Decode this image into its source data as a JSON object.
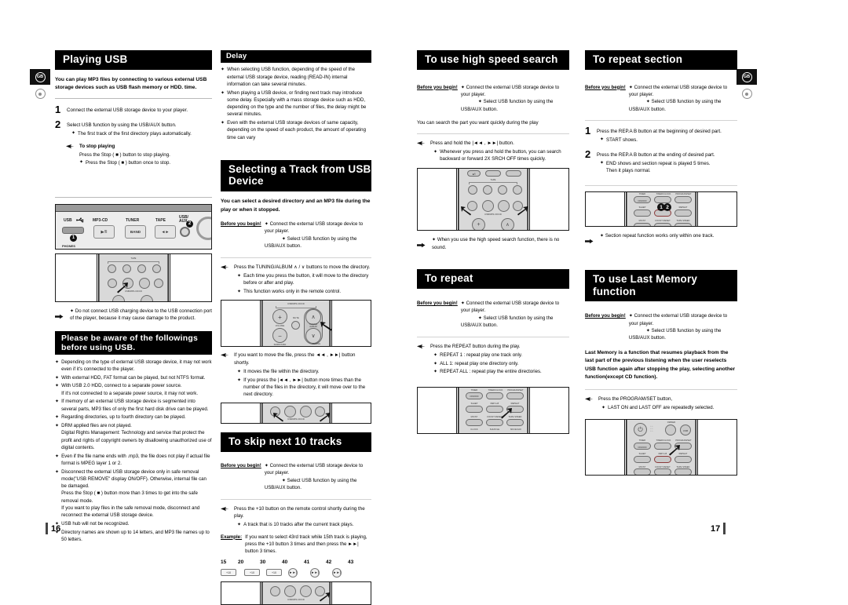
{
  "document": {
    "language_badge": "GB",
    "left_page_number": "16",
    "right_page_number": "17"
  },
  "playing_usb": {
    "title": "Playing USB",
    "intro": "You can play MP3 files by connecting to various external USB storage devices such as USB flash memory or HDD. time.",
    "step1_num": "1",
    "step1_text": "Connect the external USB storage device to your player.",
    "step2_num": "2",
    "step2_text": "Select USB function by using the USB/AUX button.",
    "step2_bullet": "The first track of the first directory plays automatically.",
    "stop_heading": "To stop playing",
    "stop_line1": "Press the Stop (  ■  ) button to stop playing.",
    "stop_bullet": "Press the Stop (  ■  ) button once to stop.",
    "note": "Do not connect USB charging device to the USB connection port of the player, because it may cause damage to the product."
  },
  "device_panel": {
    "labels": [
      "USB",
      "MP3-CD",
      "TUNER",
      "TAPE",
      "USB/\nAUX"
    ],
    "button_texts": [
      "",
      "▶/II",
      "BAND",
      "◄►",
      ""
    ],
    "callout_1": "1",
    "callout_2": "2",
    "phones_label": "PHONES"
  },
  "usb_cautions": {
    "title": "Please be aware of the followings before using USB.",
    "items": [
      "Depending on the type of external USB storage device, it may not work even if it's connected to the player.",
      "With external HDD, FAT format can be played, but not NTFS format.",
      "With USB 2.0 HDD, connect to a separate power source.\nIf it's not connected to a separate power source, it may not work.",
      "If memory of an external USB storage device is segmented into several parts, MP3 files of only the first hard disk drive can be played.",
      "Regarding directories, up to fourth directory can be played.",
      "DRM applied files are not played.\nDigital Rights Management: Technology and service that protect the profit and rights of copyright owners by disallowing unauthorized use of digital contents.",
      "Even if the file name ends with .mp3, the file does not play if actual file format is MPEG layer 1 or 2.",
      "Disconnect the external USB storage device only in safe removal mode(\"USB REMOVE\" display ON/OFF). Otherwise, internal file can be damaged.\nPress the Stop (  ■  ) button more than 3 times to get into the safe removal mode.\nIf you want to play files in the safe removal mode, disconnect and reconnect the external USB storage device.",
      "USB hub will not be recognized.",
      "Directory names are shown up to 14 letters, and MP3 file names up to 50 letters."
    ]
  },
  "delay": {
    "title": "Delay",
    "items": [
      "When selecting USB function, depending of the speed of the external USB storage device, reading (READ-IN) internal information can take several minutes.",
      "When playing a USB device, or finding next track may introduce some delay. Especially with a mass storage device such as HDD, depending on the type and the number of files, the delay might be several minutes.",
      "Even with the external USB storage devices of same capacity, depending on the speed of each product, the amount of operating time can vary"
    ]
  },
  "select_track": {
    "title": "Selecting a Track from USB Device",
    "intro": "You can select a desired directory and an MP3 file during the play or when it stopped.",
    "before_label": "Before you begin!",
    "before_items": [
      "Connect the external USB storage device to your player.",
      "Select USB function by using the USB/AUX button."
    ],
    "hand1": "Press the TUNING/ALBUM ∧ / ∨ buttons to move the directory.",
    "hand1_bullets": [
      "Each time you press the button, it will move to the directory before or after and play.",
      "This function works only in the remote control."
    ],
    "hand2": "If you want to move the file, press the ◄◄ , ►►| button shortly.",
    "hand2_bullets": [
      "It moves the file within the directory.",
      "If you press the |◄◄ , ►►| button more times than the number of the files in the directory, it will move over to the next directory."
    ],
    "remote1_labels": [
      "USB/MP3-CD/CD",
      "VOLUME",
      "MUTE",
      "TUNING/ALBUM",
      "SURROUND",
      "TUNING"
    ],
    "remote2_labels": [
      "USB/MP3-CD/CD"
    ]
  },
  "skip10": {
    "title": "To skip next 10 tracks",
    "before_label": "Before you begin!",
    "before_items": [
      "Connect the external USB storage device to your player.",
      "Select USB function by using the USB/AUX button."
    ],
    "hand": "Press the +10 button on the remote control shortly during the play.",
    "hand_bullet": "A track that is 10 tracks after the current track plays.",
    "example_label": "Example:",
    "example_text": "If you want to select 43rd track while 15th track is playing, press the +10 button 3 times and then press the ►►| button 3 times.",
    "sequence": [
      "15",
      "20",
      "30",
      "40",
      "41",
      "42",
      "43"
    ],
    "key_icons": [
      "+10",
      "+10",
      "+10",
      "►►|",
      "►►|",
      "►►|"
    ]
  },
  "high_speed_search": {
    "title": "To use high speed search",
    "before_label": "Before you begin!",
    "before_items": [
      "Connect the external USB storage device to your player.",
      "Select USB function by using the USB/AUX button."
    ],
    "intro": "You can search the part you want quickly during the play",
    "hand": "Press and hold the |◄◄ , ►►| button.",
    "hand_bullet": "Whenever you press and hold the button, you can search backward or forward 2X        SRCH OFF times quickly.",
    "note": "When you use the high speed search function, there is no sound.",
    "remote_labels": [
      "TAPE",
      "USB/MP3-CD/CD"
    ]
  },
  "to_repeat": {
    "title": "To repeat",
    "before_label": "Before you begin!",
    "before_items": [
      "Connect the external USB storage device to your player.",
      "Select USB function by using the USB/AUX button."
    ],
    "hand": "Press the REPEAT button during the play.",
    "bullets": [
      "REPEAT 1 : repeat play one track only.",
      "ALL 1: repeat play one directory only.",
      "REPEAT ALL : repeat play the entire directories."
    ],
    "remote_labels": [
      "TIMER",
      "ON/OFF",
      "TIMER/CLOCK",
      "PROGRAM/SET",
      "SLEEP",
      "REP.A-B",
      "REPEAT",
      "MO/ST",
      "COUNT RESET",
      "TAPE SPEED"
    ]
  },
  "repeat_section": {
    "title": "To repeat section",
    "before_label": "Before you begin!",
    "before_items": [
      "Connect the external USB storage device to your player.",
      "Select USB function by using the USB/AUX button."
    ],
    "step1_num": "1",
    "step1_text": "Press the REP.A   B button at the beginning of desired part.",
    "step1_bullet": "START shows.",
    "step2_num": "2",
    "step2_text": "Press the REP.A   B button at the ending of desired part.",
    "step2_bullets": [
      "END shows and section repeat is played 5 times.\nThen it plays normal."
    ],
    "note": "Section repeat function works only within one track.",
    "callouts": [
      "1",
      "2"
    ],
    "remote_labels": [
      "TIMER",
      "ON/OFF",
      "TIMER/CLOCK",
      "PROGRAM/SET",
      "SLEEP",
      "REP.A-B",
      "REPEAT",
      "MO/ST",
      "COUNT RESET",
      "TAPE SPEED"
    ]
  },
  "last_memory": {
    "title": "To use Last Memory function",
    "before_label": "Before you begin!",
    "before_items": [
      "Connect the external USB storage device to your player.",
      "Select USB function by using the USB/AUX button."
    ],
    "description": "Last Memory is a function that resumes playback from the last part of the previous listening when the user reselects USB function again after stopping the play, selecting another function(except CD function).",
    "hand": "Press the PROGRAM/SET button,",
    "hand_bullet": "LAST ON and LAST OFF are repeatedly selected.",
    "remote_labels": [
      "OWNER",
      "USB",
      "TIMER",
      "ON/OFF",
      "TIMER/CLOCK",
      "PROGRAM/SET",
      "SLEEP",
      "REP.A-B",
      "REPEAT",
      "MO/ST",
      "COUNT RESET",
      "TAPE SPEED"
    ]
  }
}
